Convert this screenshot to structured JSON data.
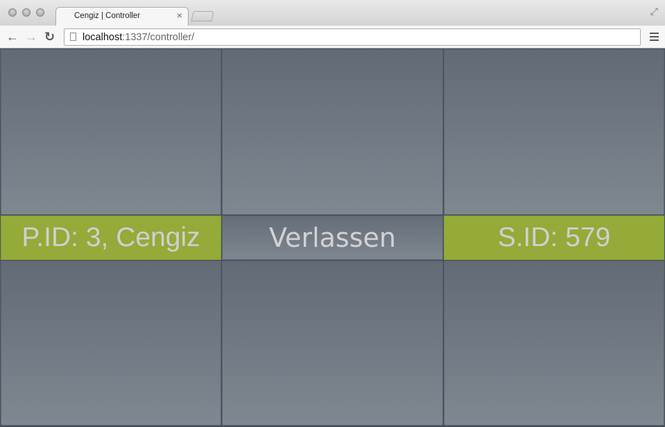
{
  "browser": {
    "tab_title": "Cengiz | Controller",
    "tab_close": "×",
    "url_host": "localhost",
    "url_rest": ":1337/controller/",
    "back_glyph": "←",
    "forward_glyph": "→",
    "reload_glyph": "↻",
    "fullscreen_glyph": "⤢"
  },
  "controller": {
    "player_label": "P.ID: 3, Cengiz",
    "leave_label": "Verlassen",
    "session_label": "S.ID: 579"
  },
  "colors": {
    "accent_green": "#94aa39",
    "panel_gray": "#6f7882"
  }
}
